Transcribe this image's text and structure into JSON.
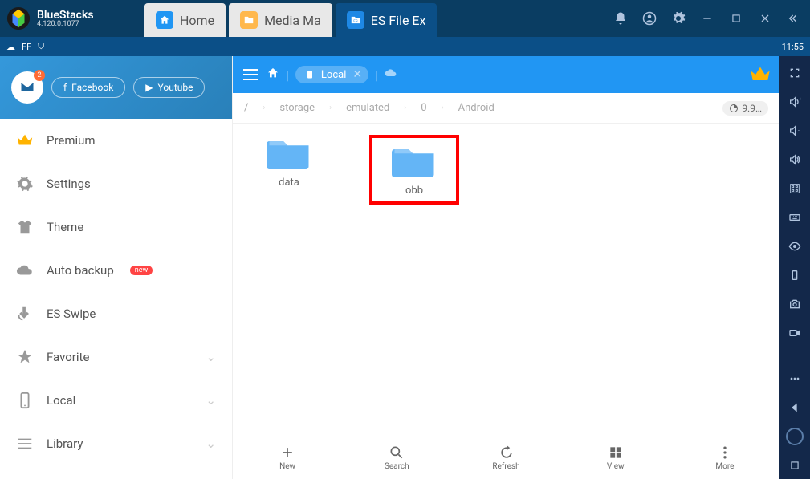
{
  "app": {
    "name": "BlueStacks",
    "version": "4.120.0.1077"
  },
  "tabs": [
    {
      "label": "Home",
      "icon": "home"
    },
    {
      "label": "Media Ma",
      "icon": "media"
    },
    {
      "label": "ES File Ex",
      "icon": "es"
    }
  ],
  "status": {
    "ff": "FF",
    "time": "11:55"
  },
  "sidebar_header": {
    "mail_badge": "2",
    "facebook": "Facebook",
    "youtube": "Youtube"
  },
  "sidebar": [
    {
      "label": "Premium",
      "icon": "crown"
    },
    {
      "label": "Settings",
      "icon": "gear"
    },
    {
      "label": "Theme",
      "icon": "shirt"
    },
    {
      "label": "Auto backup",
      "icon": "cloud",
      "badge": "new"
    },
    {
      "label": "ES Swipe",
      "icon": "swipe"
    },
    {
      "label": "Favorite",
      "icon": "star",
      "expandable": true
    },
    {
      "label": "Local",
      "icon": "phone",
      "expandable": true
    },
    {
      "label": "Library",
      "icon": "library",
      "expandable": true
    }
  ],
  "pathbar": {
    "chip_label": "Local"
  },
  "breadcrumb": [
    "/",
    "storage",
    "emulated",
    "0",
    "Android"
  ],
  "disk": "9.9…",
  "folders": [
    {
      "name": "data",
      "highlighted": false
    },
    {
      "name": "obb",
      "highlighted": true
    }
  ],
  "bottom": [
    {
      "label": "New",
      "icon": "plus"
    },
    {
      "label": "Search",
      "icon": "search"
    },
    {
      "label": "Refresh",
      "icon": "refresh"
    },
    {
      "label": "View",
      "icon": "grid"
    },
    {
      "label": "More",
      "icon": "more"
    }
  ]
}
